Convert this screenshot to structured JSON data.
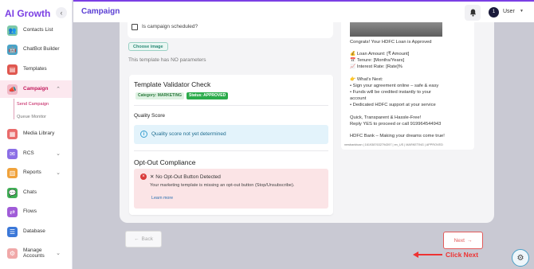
{
  "sidebar": {
    "brand": "AI Growth",
    "collapse_icon": "‹",
    "items": [
      {
        "label": "Contacts List",
        "icon": "contacts-icon",
        "glyph": "👥",
        "color": "#7cc8a8"
      },
      {
        "label": "ChatBot Builder",
        "icon": "chatbot-icon",
        "glyph": "🤖",
        "color": "#4aa3c6"
      },
      {
        "label": "Templates",
        "icon": "templates-icon",
        "glyph": "▤",
        "color": "#e0574f"
      },
      {
        "label": "Campaign",
        "icon": "campaign-icon",
        "glyph": "📣",
        "color": "#f2b7c6",
        "chevron": "⌃"
      },
      {
        "label": "Media Library",
        "icon": "media-library-icon",
        "glyph": "▦",
        "color": "#e96b6b"
      },
      {
        "label": "RCS",
        "icon": "rcs-icon",
        "glyph": "✉",
        "color": "#8b6ee6",
        "chevron": "⌄"
      },
      {
        "label": "Reports",
        "icon": "reports-icon",
        "glyph": "▥",
        "color": "#f0a23b",
        "chevron": "⌄"
      },
      {
        "label": "Chats",
        "icon": "chats-icon",
        "glyph": "💬",
        "color": "#3fae55"
      },
      {
        "label": "Flows",
        "icon": "flows-icon",
        "glyph": "⇄",
        "color": "#a05cd8"
      },
      {
        "label": "Database",
        "icon": "database-icon",
        "glyph": "☰",
        "color": "#3b78d8"
      },
      {
        "label": "Manage\nAccounts",
        "icon": "manage-accounts-icon",
        "glyph": "⚙",
        "color": "#f0a8a8",
        "chevron": "⌄"
      }
    ],
    "campaign_sub": [
      "Send Campaign",
      "Queue Monitor"
    ]
  },
  "header": {
    "title": "Campaign",
    "user_initial": "1",
    "user_name": "User",
    "user_chevron": "▼"
  },
  "form": {
    "schedule_label": "Is campaign scheduled?",
    "choose_image": "Choose image",
    "no_params": "This template has NO parameters"
  },
  "validator": {
    "title": "Template Validator Check",
    "category": "Category: MARKETING",
    "status": "Status: APPROVED",
    "quality_title": "Quality Score",
    "quality_icon": "i",
    "quality_text": "Quality score not yet determined",
    "optout_title": "Opt-Out Compliance",
    "optout_icon": "×",
    "optout_head": "✕ No Opt-Out Button Detected",
    "optout_desc": "Your marketing template is missing an opt-out button (Stop/Unsubscribe).",
    "learn_more": "Learn more"
  },
  "preview": {
    "lines": [
      "Congrats! Your HDFC Loan is Approved",
      "💰 Loan Amount: [₹ Amount]",
      "📅 Tenure: [Months/Years]",
      "📈 Interest Rate: [Rate]%",
      "👉 What's Next:",
      "• Sign your agreement online – safe & easy",
      "• Funds will be credited instantly to your",
      "account",
      "• Dedicated HDFC support at your service",
      "Quick, Transparent & Hassle-Free!",
      "Reply YES to proceed or call 919964544943",
      "HDFC Bank – Making your dreams come true!"
    ],
    "footer": "newbanktoan | 1619387632794397 | en_US | MARKETING | APPROVED"
  },
  "buttons": {
    "back": "Back",
    "back_icon": "←",
    "next": "Next",
    "next_icon": "→",
    "annotation": "Click Next"
  }
}
